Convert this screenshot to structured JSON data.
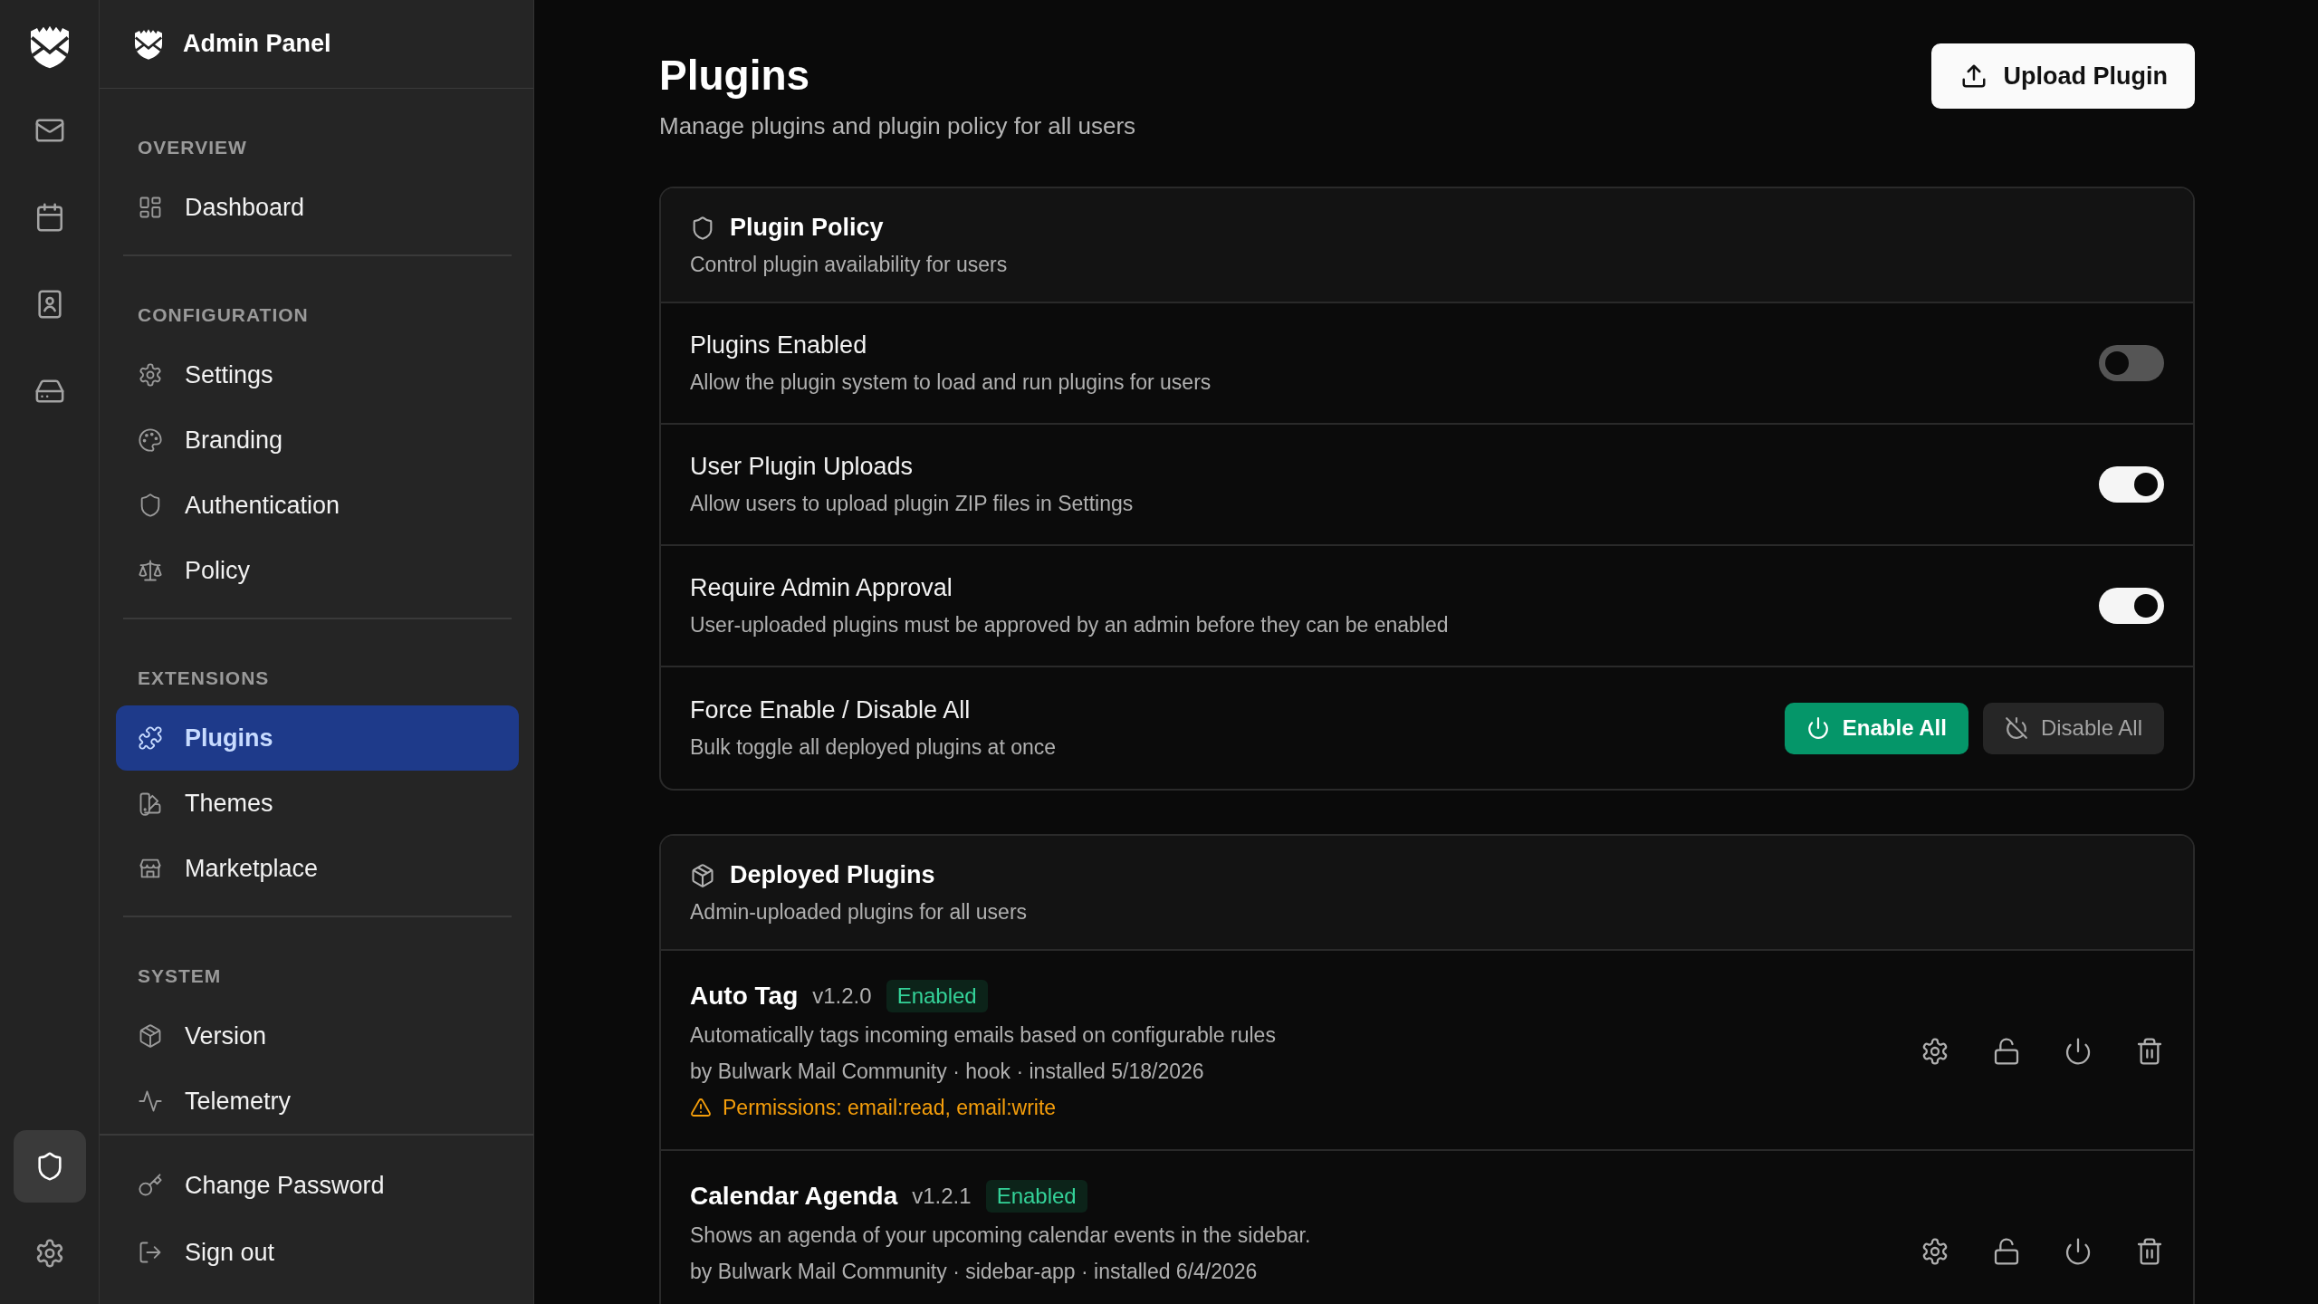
{
  "rail": {
    "top_items": [
      {
        "selected": false
      },
      {
        "selected": false
      },
      {
        "selected": false
      },
      {
        "selected": false
      }
    ],
    "bottom_items": [
      {
        "selected": true
      },
      {
        "selected": false
      }
    ]
  },
  "sidebar": {
    "title": "Admin Panel",
    "sections": [
      {
        "heading": "OVERVIEW",
        "items": [
          {
            "label": "Dashboard",
            "selected": false
          }
        ]
      },
      {
        "heading": "CONFIGURATION",
        "items": [
          {
            "label": "Settings",
            "selected": false
          },
          {
            "label": "Branding",
            "selected": false
          },
          {
            "label": "Authentication",
            "selected": false
          },
          {
            "label": "Policy",
            "selected": false
          }
        ]
      },
      {
        "heading": "EXTENSIONS",
        "items": [
          {
            "label": "Plugins",
            "selected": true
          },
          {
            "label": "Themes",
            "selected": false
          },
          {
            "label": "Marketplace",
            "selected": false
          }
        ]
      },
      {
        "heading": "SYSTEM",
        "items": [
          {
            "label": "Version",
            "selected": false
          },
          {
            "label": "Telemetry",
            "selected": false
          }
        ]
      }
    ],
    "footer_items": [
      {
        "label": "Change Password"
      },
      {
        "label": "Sign out"
      }
    ]
  },
  "page": {
    "title": "Plugins",
    "subtitle": "Manage plugins and plugin policy for all users",
    "upload_button": "Upload Plugin"
  },
  "policy": {
    "title": "Plugin Policy",
    "subtitle": "Control plugin availability for users",
    "rows": [
      {
        "kind": "toggle",
        "label": "Plugins Enabled",
        "description": "Allow the plugin system to load and run plugins for users",
        "on": false
      },
      {
        "kind": "toggle",
        "label": "User Plugin Uploads",
        "description": "Allow users to upload plugin ZIP files in Settings",
        "on": true
      },
      {
        "kind": "toggle",
        "label": "Require Admin Approval",
        "description": "User-uploaded plugins must be approved by an admin before they can be enabled",
        "on": true
      },
      {
        "kind": "actions",
        "label": "Force Enable / Disable All",
        "description": "Bulk toggle all deployed plugins at once",
        "buttons": [
          {
            "label": "Enable All",
            "kind": "primary"
          },
          {
            "label": "Disable All",
            "kind": "secondary"
          }
        ]
      }
    ]
  },
  "deployed": {
    "title": "Deployed Plugins",
    "subtitle": "Admin-uploaded plugins for all users",
    "plugins": [
      {
        "name": "Auto Tag",
        "version": "v1.2.0",
        "status": "Enabled",
        "enabled": true,
        "description": "Automatically tags incoming emails based on configurable rules",
        "meta": "by Bulwark Mail Community · hook · installed 5/18/2026",
        "permissions": "Permissions: email:read, email:write"
      },
      {
        "name": "Calendar Agenda",
        "version": "v1.2.1",
        "status": "Enabled",
        "enabled": true,
        "description": "Shows an agenda of your upcoming calendar events in the sidebar.",
        "meta": "by Bulwark Mail Community · sidebar-app · installed 6/4/2026"
      }
    ]
  }
}
